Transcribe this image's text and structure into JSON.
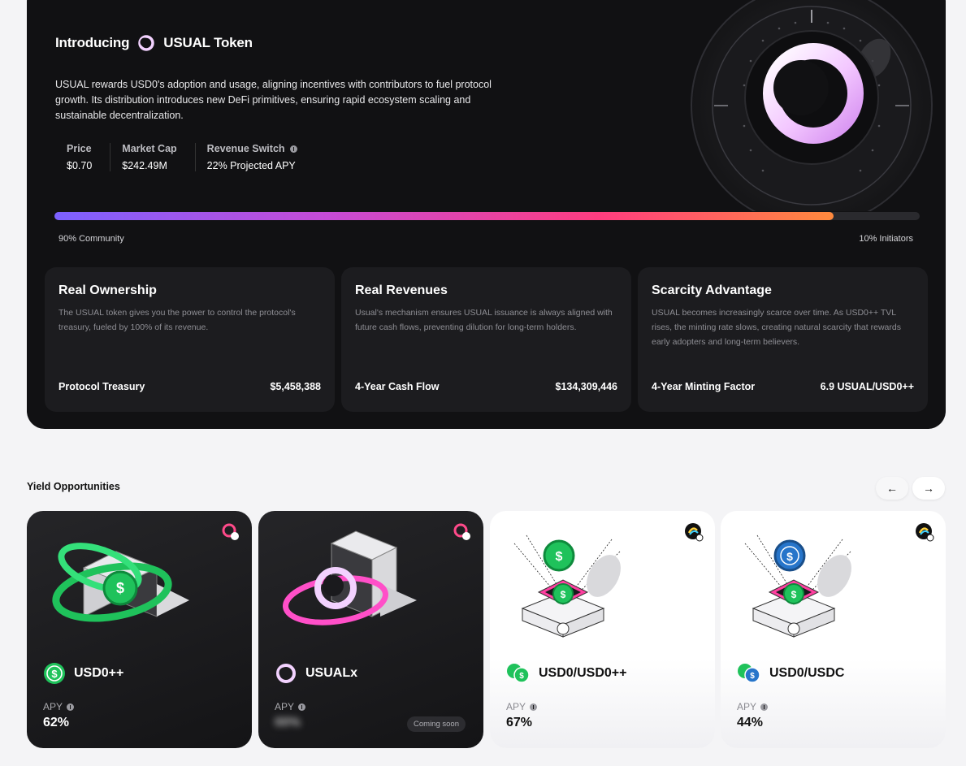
{
  "hero": {
    "title_prefix": "Introducing",
    "title_token": "USUAL Token",
    "description": "USUAL rewards USD0's adoption and usage, aligning incentives with contributors to fuel protocol growth. Its distribution introduces new DeFi primitives, ensuring rapid ecosystem scaling and sustainable decentralization.",
    "stats": [
      {
        "label": "Price",
        "value": "$0.70"
      },
      {
        "label": "Market Cap",
        "value": "$242.49M"
      },
      {
        "label": "Revenue Switch",
        "value": "22% Projected APY",
        "info_icon": "info-icon"
      }
    ],
    "distribution": {
      "community_pct": 90,
      "left_label": "90% Community",
      "right_label": "10% Initiators"
    },
    "features": [
      {
        "title": "Real Ownership",
        "description": "The USUAL token gives you the power to control the protocol's treasury, fueled by 100% of its revenue.",
        "metric_label": "Protocol Treasury",
        "metric_value": "$5,458,388"
      },
      {
        "title": "Real Revenues",
        "description": "Usual's mechanism ensures USUAL issuance is always aligned with future cash flows, preventing dilution for long-term holders.",
        "metric_label": "4-Year Cash Flow",
        "metric_value": "$134,309,446"
      },
      {
        "title": "Scarcity Advantage",
        "description": "USUAL becomes increasingly scarce over time. As USD0++ TVL rises, the minting rate slows, creating natural scarcity that rewards early adopters and long-term believers.",
        "metric_label": "4-Year Minting Factor",
        "metric_value": "6.9 USUAL/USD0++"
      }
    ]
  },
  "yield": {
    "title": "Yield Opportunities",
    "prev_icon": "arrow-left-icon",
    "next_icon": "arrow-right-icon",
    "prev_glyph": "←",
    "next_glyph": "→",
    "cards": [
      {
        "name": "USD0++",
        "apy_label": "APY",
        "apy_value": "62%",
        "theme": "dark",
        "icon": "usd0-coin-icon"
      },
      {
        "name": "USUALx",
        "apy_label": "APY",
        "apy_value": "00%",
        "theme": "dark",
        "icon": "usual-ring-icon",
        "badge": "Coming soon"
      },
      {
        "name": "USD0/USD0++",
        "apy_label": "APY",
        "apy_value": "67%",
        "theme": "light",
        "icon": "usd0-pair-icon"
      },
      {
        "name": "USD0/USDC",
        "apy_label": "APY",
        "apy_value": "44%",
        "theme": "light",
        "icon": "usd0-usdc-pair-icon"
      }
    ]
  },
  "colors": {
    "accent_green": "#1fc25b",
    "accent_pink": "#f0b8ff",
    "usdc_blue": "#2775ca",
    "bar_gradient": [
      "#7b61ff",
      "#ff3d7f",
      "#ff8a3d"
    ]
  }
}
